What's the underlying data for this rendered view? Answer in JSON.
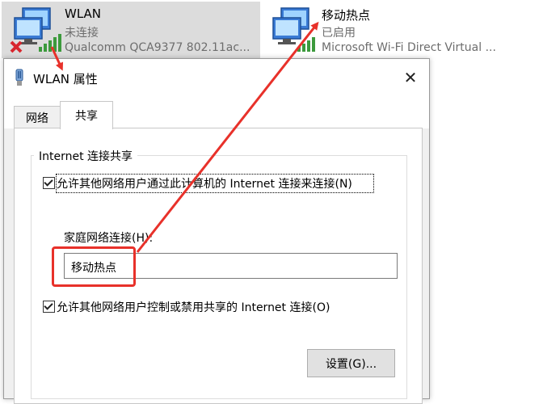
{
  "adapters": {
    "wlan": {
      "name": "WLAN",
      "status": "未连接",
      "device": "Qualcomm QCA9377 802.11ac..."
    },
    "hotspot": {
      "name": "移动热点",
      "status": "已启用",
      "device": "Microsoft Wi-Fi Direct Virtual ..."
    }
  },
  "dialog": {
    "title": "WLAN 属性",
    "close_symbol": "✕",
    "tabs": [
      {
        "label": "网络"
      },
      {
        "label": "共享"
      }
    ],
    "group_title": "Internet 连接共享",
    "allow_share_label": "允许其他网络用户通过此计算机的 Internet 连接来连接(N)",
    "home_network_label": "家庭网络连接(H):",
    "home_network_value": "移动热点",
    "allow_control_label": "允许其他网络用户控制或禁用共享的 Internet 连接(O)",
    "settings_button": "设置(G)..."
  },
  "colors": {
    "annotation_red": "#e8312a",
    "selected_tile": "#dcdcdc"
  },
  "icons": [
    "network-adapter-icon",
    "disconnected-x-icon",
    "signal-bars-icon",
    "wlan-adapter-icon",
    "close-icon",
    "checkbox-checked-icon",
    "annotation-arrow"
  ]
}
